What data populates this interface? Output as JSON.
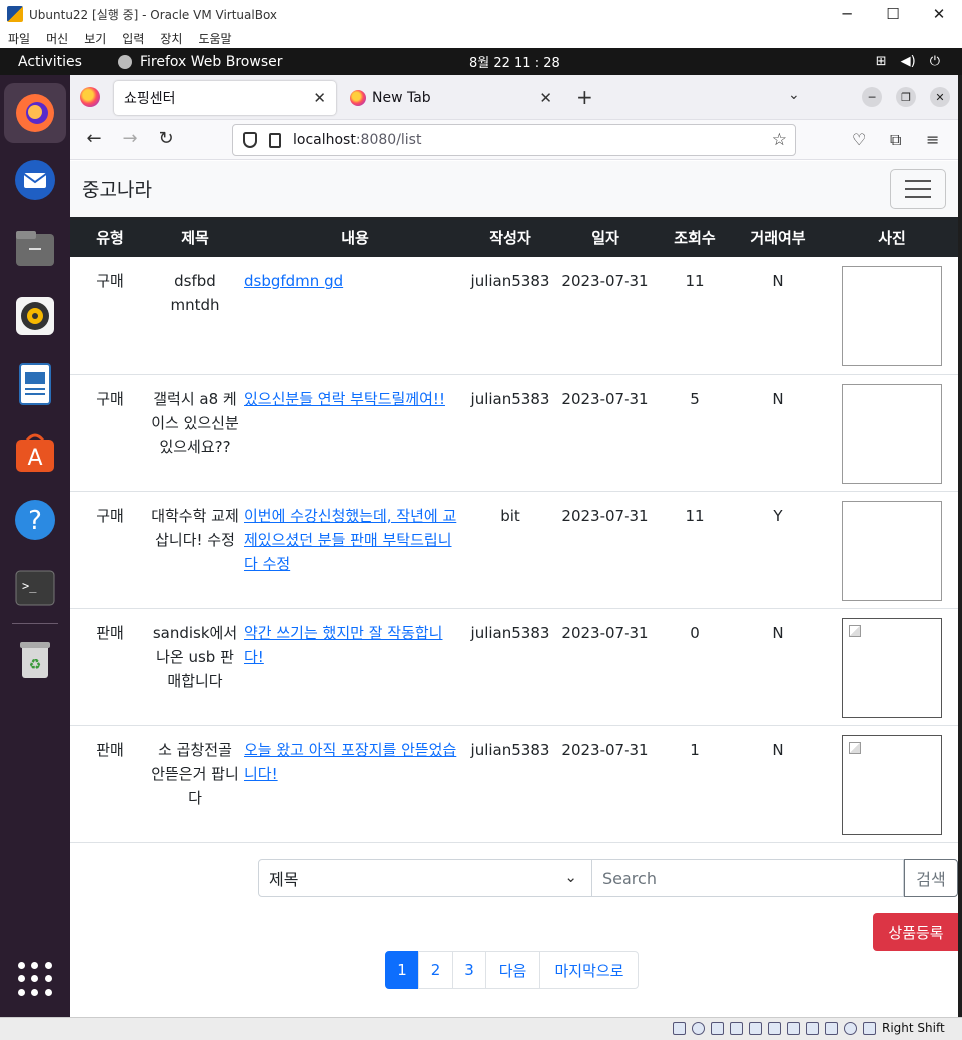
{
  "virtualbox": {
    "title": "Ubuntu22 [실행 중] - Oracle VM VirtualBox",
    "menu": [
      "파일",
      "머신",
      "보기",
      "입력",
      "장치",
      "도움말"
    ],
    "host_key": "Right Shift"
  },
  "gnome": {
    "activities": "Activities",
    "app_name": "Firefox Web Browser",
    "clock": "8월 22  11 : 28"
  },
  "browser": {
    "tabs": [
      {
        "title": "쇼핑센터",
        "active": true
      },
      {
        "title": "New Tab",
        "active": false
      }
    ],
    "url_host": "localhost",
    "url_path": ":8080/list"
  },
  "site": {
    "brand": "중고나라",
    "columns": [
      "유형",
      "제목",
      "내용",
      "작성자",
      "일자",
      "조회수",
      "거래여부",
      "사진"
    ],
    "rows": [
      {
        "type": "구매",
        "title": "dsfbd mntdh",
        "content": "dsbgfdmn gd",
        "author": "julian5383",
        "date": "2023-07-31",
        "views": "11",
        "deal": "N",
        "photo": "empty"
      },
      {
        "type": "구매",
        "title": "갤럭시 a8 케이스 있으신분 있으세요??",
        "content": "있으신분들 연락 부탁드릴께여!!",
        "author": "julian5383",
        "date": "2023-07-31",
        "views": "5",
        "deal": "N",
        "photo": "empty"
      },
      {
        "type": "구매",
        "title": "대학수학 교제 삽니다! 수정",
        "content": "이번에 수강신청했는데, 작년에 교제있으셨던 분들 판매 부탁드립니다 수정",
        "author": "bit",
        "date": "2023-07-31",
        "views": "11",
        "deal": "Y",
        "photo": "empty"
      },
      {
        "type": "판매",
        "title": "sandisk에서 나온 usb 판매합니다",
        "content": "약간 쓰기는 했지만 잘 작동합니다!",
        "author": "julian5383",
        "date": "2023-07-31",
        "views": "0",
        "deal": "N",
        "photo": "broken"
      },
      {
        "type": "판매",
        "title": "소 곱창전골 안뜯은거 팝니다",
        "content": "오늘 왔고 아직 포장지를 안뜯었습니다!",
        "author": "julian5383",
        "date": "2023-07-31",
        "views": "1",
        "deal": "N",
        "photo": "broken"
      }
    ],
    "search": {
      "field_selected": "제목",
      "placeholder": "Search",
      "button": "검색"
    },
    "register_button": "상품등록",
    "pagination": [
      "1",
      "2",
      "3",
      "다음",
      "마지막으로"
    ],
    "current_page": "1"
  },
  "colors": {
    "table_header": "#212529",
    "link": "#0d6efd",
    "register": "#dc3545",
    "dock": "#2b1d2f"
  }
}
